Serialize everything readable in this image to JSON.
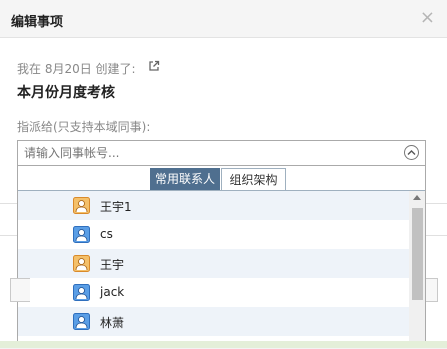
{
  "dialog": {
    "title": "编辑事项",
    "close_glyph": "×"
  },
  "task": {
    "creator_text": "我在 8月20日 创建了:",
    "title": "本月份月度考核"
  },
  "assign": {
    "label": "指派给(只支持本域同事):",
    "placeholder": "请输入同事帐号..."
  },
  "tabs": [
    {
      "label": "常用联系人",
      "active": true
    },
    {
      "label": "组织架构",
      "active": false
    }
  ],
  "contacts": [
    {
      "name": "王宇1",
      "avatar": "orange-user-icon"
    },
    {
      "name": "cs",
      "avatar": "blue-user-icon"
    },
    {
      "name": "王宇",
      "avatar": "orange-user-icon"
    },
    {
      "name": "jack",
      "avatar": "blue-user-icon"
    },
    {
      "name": "林萧",
      "avatar": "blue-user-icon"
    },
    {
      "name": "",
      "avatar": "orange-user-icon"
    }
  ],
  "colors": {
    "tab_active": "#4f6f8f",
    "row_alt": "#eef3f9",
    "avatar_orange": "#d98a2b",
    "avatar_blue": "#3a7fd0"
  }
}
